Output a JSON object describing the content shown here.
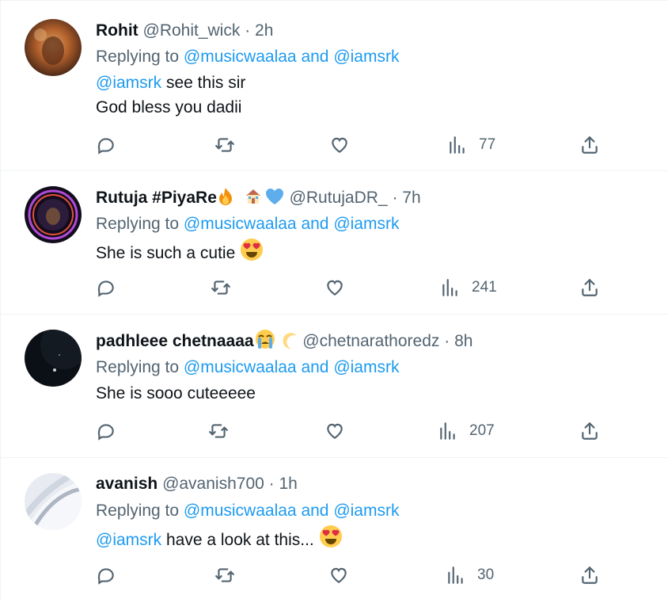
{
  "replies": [
    {
      "name": "Rohit",
      "handle": "@Rohit_wick",
      "sep": "·",
      "time": "2h",
      "replying_prefix": "Replying to",
      "replying_to": "@musicwaalaa and @iamsrk",
      "text_mention": "@iamsrk",
      "text_line1": " see this sir",
      "text_line2": "God bless you dadii",
      "views": "77",
      "avatar_colors": [
        "#3a1f14",
        "#b5622c",
        "#d9a066"
      ]
    },
    {
      "name": "Rutuja #PiyaRe",
      "handle": "@RutujaDR_",
      "sep": "·",
      "time": "7h",
      "replying_prefix": "Replying to",
      "replying_to": "@musicwaalaa and @iamsrk",
      "text_line1": "She is such a cutie",
      "views": "241",
      "avatar_colors": [
        "#120c1c",
        "#b04ad8",
        "#e8503a"
      ]
    },
    {
      "name": "padhleee chetnaaaa",
      "handle": "@chetnarathoredz",
      "sep": "·",
      "time": "8h",
      "replying_prefix": "Replying to",
      "replying_to": "@musicwaalaa and @iamsrk",
      "text_line1": "She is sooo cuteeeee",
      "views": "207",
      "avatar_colors": [
        "#0b0f16",
        "#1a212b"
      ]
    },
    {
      "name": "avanish",
      "handle": "@avanish700",
      "sep": "·",
      "time": "1h",
      "replying_prefix": "Replying to",
      "replying_to": "@musicwaalaa and @iamsrk",
      "text_mention": "@iamsrk",
      "text_line1": " have a look at this...",
      "views": "30",
      "avatar_colors": [
        "#d8dde6",
        "#f2f4f8",
        "#aeb6c4"
      ]
    }
  ],
  "icons": [
    "reply-icon",
    "retweet-icon",
    "like-icon",
    "views-icon",
    "share-icon",
    "fire-emoji",
    "house-emoji",
    "blue-heart-emoji",
    "heart-eyes-emoji",
    "crying-emoji",
    "crescent-moon-emoji"
  ],
  "colors": {
    "link": "#1d9bf0",
    "muted": "#536471",
    "text": "#0f1419",
    "divider": "#eff3f4"
  }
}
